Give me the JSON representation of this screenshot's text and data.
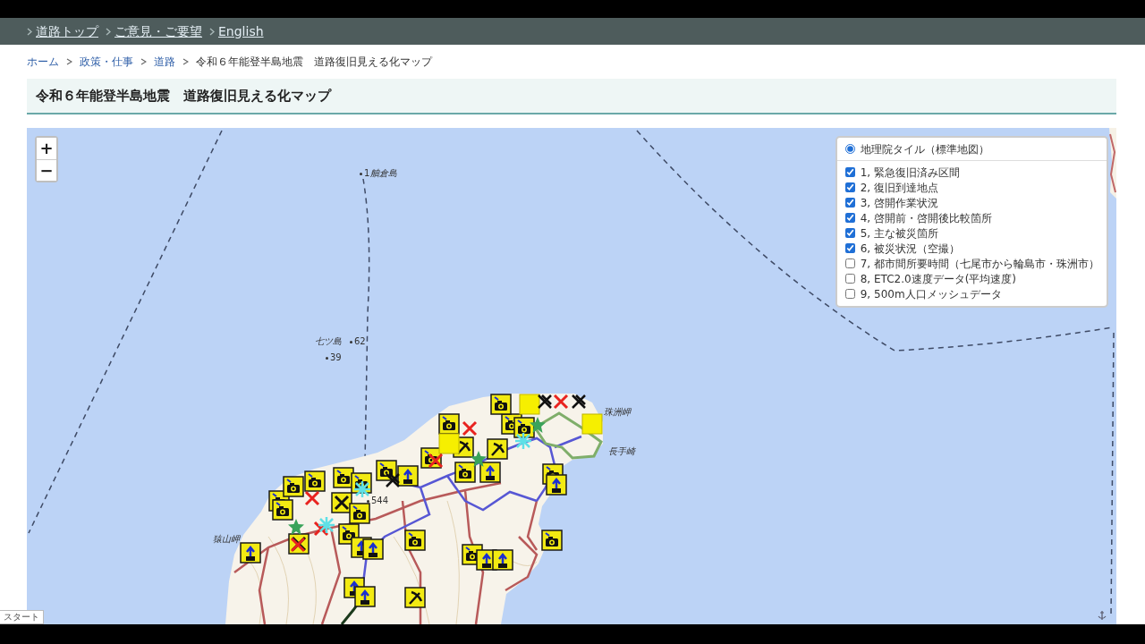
{
  "nav_links": [
    {
      "label": "道路トップ"
    },
    {
      "label": "ご意見・ご要望"
    },
    {
      "label": "English"
    }
  ],
  "breadcrumb": [
    {
      "label": "ホーム",
      "link": true
    },
    {
      "label": "政策・仕事",
      "link": true
    },
    {
      "label": "道路",
      "link": true
    },
    {
      "label": "令和６年能登半島地震　道路復旧見える化マップ",
      "link": false
    }
  ],
  "page_title": "令和６年能登半島地震　道路復旧見える化マップ",
  "map": {
    "zoom_controls": [
      "+",
      "−"
    ],
    "base_layers": [
      {
        "label": "地理院タイル（標準地図）",
        "selected": true
      }
    ],
    "overlays": [
      {
        "label": "1, 緊急復旧済み区間",
        "checked": true
      },
      {
        "label": "2, 復旧到達地点",
        "checked": true
      },
      {
        "label": "3, 啓開作業状況",
        "checked": true
      },
      {
        "label": "4, 啓開前・啓開後比較箇所",
        "checked": true
      },
      {
        "label": "5, 主な被災箇所",
        "checked": true
      },
      {
        "label": "6, 被災状況（空撮）",
        "checked": true
      },
      {
        "label": "7, 都市間所要時間（七尾市から輪島市・珠洲市）",
        "checked": false
      },
      {
        "label": "8, ETC2.0速度データ(平均速度)",
        "checked": false
      },
      {
        "label": "9, 500m人口メッシュデータ",
        "checked": false
      }
    ],
    "labels": [
      {
        "text": "1",
        "kind": "height"
      },
      {
        "text": "舳倉島",
        "kind": "place"
      },
      {
        "text": "七ツ島",
        "kind": "place"
      },
      {
        "text": "62",
        "kind": "height"
      },
      {
        "text": "39",
        "kind": "height"
      },
      {
        "text": "544",
        "kind": "height"
      },
      {
        "text": "珠洲岬",
        "kind": "place"
      },
      {
        "text": "長手崎",
        "kind": "place"
      },
      {
        "text": "猿山岬",
        "kind": "place"
      }
    ]
  },
  "start_tab": "スタート"
}
